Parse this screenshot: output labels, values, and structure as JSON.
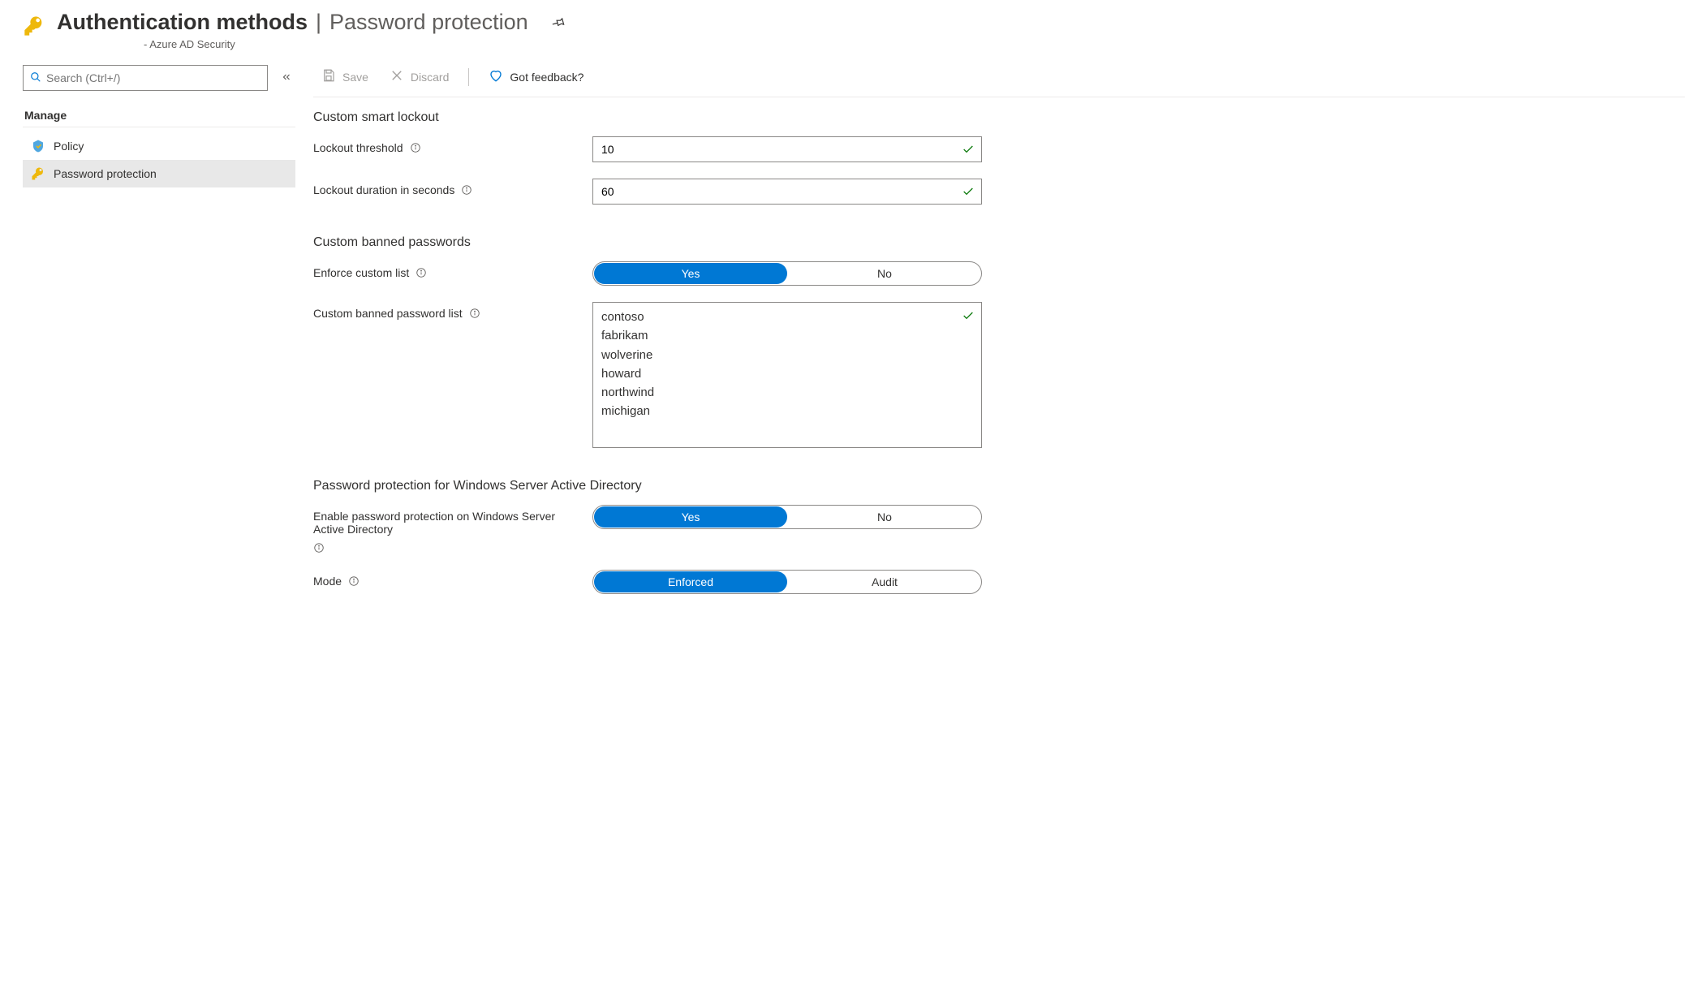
{
  "header": {
    "title_primary": "Authentication methods",
    "title_secondary": "Password protection",
    "subtitle": " - Azure AD Security"
  },
  "sidebar": {
    "search_placeholder": "Search (Ctrl+/)",
    "section_label": "Manage",
    "items": [
      {
        "label": "Policy",
        "icon": "policy"
      },
      {
        "label": "Password protection",
        "icon": "key",
        "active": true
      }
    ]
  },
  "toolbar": {
    "save_label": "Save",
    "discard_label": "Discard",
    "feedback_label": "Got feedback?"
  },
  "sections": {
    "lockout": {
      "title": "Custom smart lockout",
      "threshold_label": "Lockout threshold",
      "threshold_value": "10",
      "duration_label": "Lockout duration in seconds",
      "duration_value": "60"
    },
    "banned": {
      "title": "Custom banned passwords",
      "enforce_label": "Enforce custom list",
      "enforce_yes": "Yes",
      "enforce_no": "No",
      "list_label": "Custom banned password list",
      "list_values": [
        "contoso",
        "fabrikam",
        "wolverine",
        "howard",
        "northwind",
        "michigan"
      ]
    },
    "winsrv": {
      "title": "Password protection for Windows Server Active Directory",
      "enable_label": "Enable password protection on Windows Server Active Directory",
      "enable_yes": "Yes",
      "enable_no": "No",
      "mode_label": "Mode",
      "mode_enforced": "Enforced",
      "mode_audit": "Audit"
    }
  }
}
